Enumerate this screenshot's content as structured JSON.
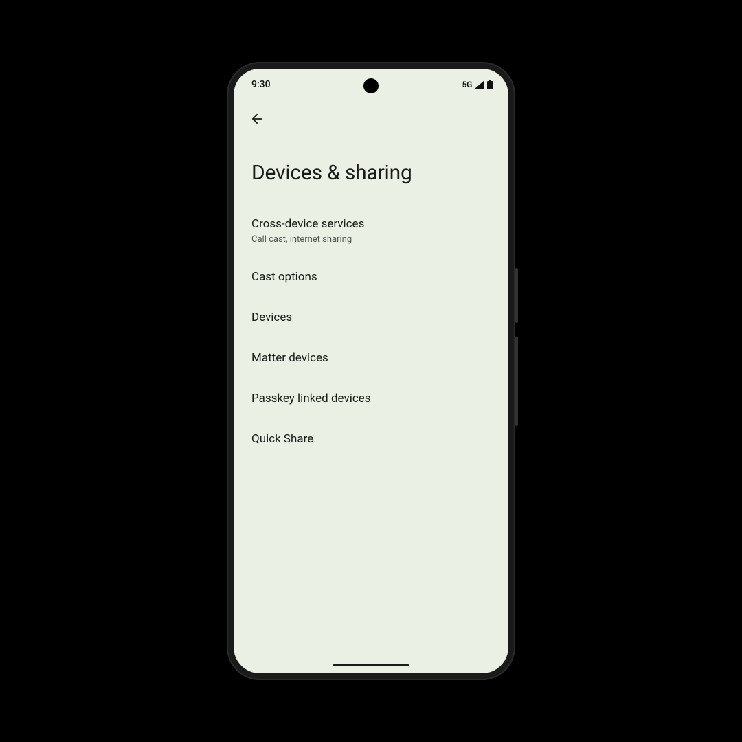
{
  "status": {
    "time": "9:30",
    "network_label": "5G"
  },
  "page": {
    "title": "Devices & sharing"
  },
  "items": [
    {
      "title": "Cross-device services",
      "subtitle": "Call cast, internet sharing"
    },
    {
      "title": "Cast options",
      "subtitle": ""
    },
    {
      "title": "Devices",
      "subtitle": ""
    },
    {
      "title": "Matter devices",
      "subtitle": ""
    },
    {
      "title": "Passkey linked devices",
      "subtitle": ""
    },
    {
      "title": "Quick Share",
      "subtitle": ""
    }
  ]
}
